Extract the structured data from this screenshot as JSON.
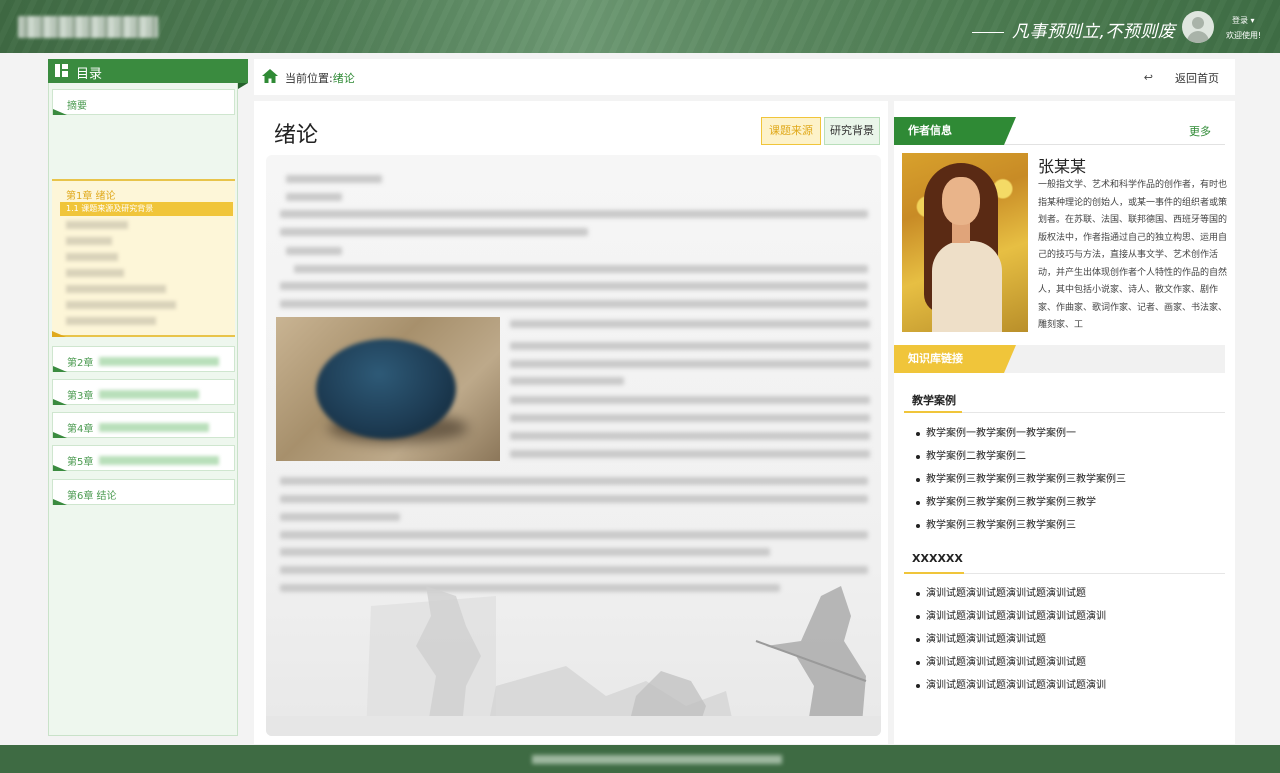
{
  "header": {
    "motto": "凡事预则立,不预则废",
    "login": "登录 ▾",
    "welcome": "欢迎使用!"
  },
  "sidebar": {
    "title": "目录",
    "items": [
      {
        "label": "摘要"
      },
      {
        "label": "第1章  绪论",
        "active_sub": "1.1 课题来源及研究背景"
      },
      {
        "label": "第2章"
      },
      {
        "label": "第3章"
      },
      {
        "label": "第4章"
      },
      {
        "label": "第5章"
      },
      {
        "label": "第6章  结论"
      }
    ]
  },
  "breadcrumb": {
    "prefix": "当前位置:",
    "current": "绪论",
    "back": "返回首页"
  },
  "main": {
    "title": "绪论",
    "tabs": [
      {
        "label": "课题来源"
      },
      {
        "label": "研究背景"
      }
    ]
  },
  "author": {
    "section_title": "作者信息",
    "more": "更多",
    "name": "张某某",
    "bio": "一般指文学、艺术和科学作品的创作者，有时也指某种理论的创始人，或某一事件的组织者或策划者。在苏联、法国、联邦德国、西班牙等国的版权法中，作者指通过自己的独立构思、运用自己的技巧与方法，直接从事文学、艺术创作活动，并产生出体现创作者个人特性的作品的自然人，其中包括小说家、诗人、散文作家、剧作家、作曲家、歌词作家、记者、画家、书法家、雕刻家、工"
  },
  "knowledge": {
    "section_title": "知识库链接",
    "sections": [
      {
        "title": "教学案例",
        "items": [
          "教学案例一教学案例一教学案例一",
          "教学案例二教学案例二",
          "教学案例三教学案例三教学案例三教学案例三",
          "教学案例三教学案例三教学案例三教学",
          "教学案例三教学案例三教学案例三"
        ]
      },
      {
        "title": "XXXXXX",
        "items": [
          "演训试题演训试题演训试题演训试题",
          "演训试题演训试题演训试题演训试题演训",
          "演训试题演训试题演训试题",
          "演训试题演训试题演训试题演训试题",
          "演训试题演训试题演训试题演训试题演训"
        ]
      }
    ]
  },
  "colors": {
    "primary_green": "#2f8a35",
    "accent_yellow": "#f0c53a",
    "header_green": "#4a7a4f"
  }
}
